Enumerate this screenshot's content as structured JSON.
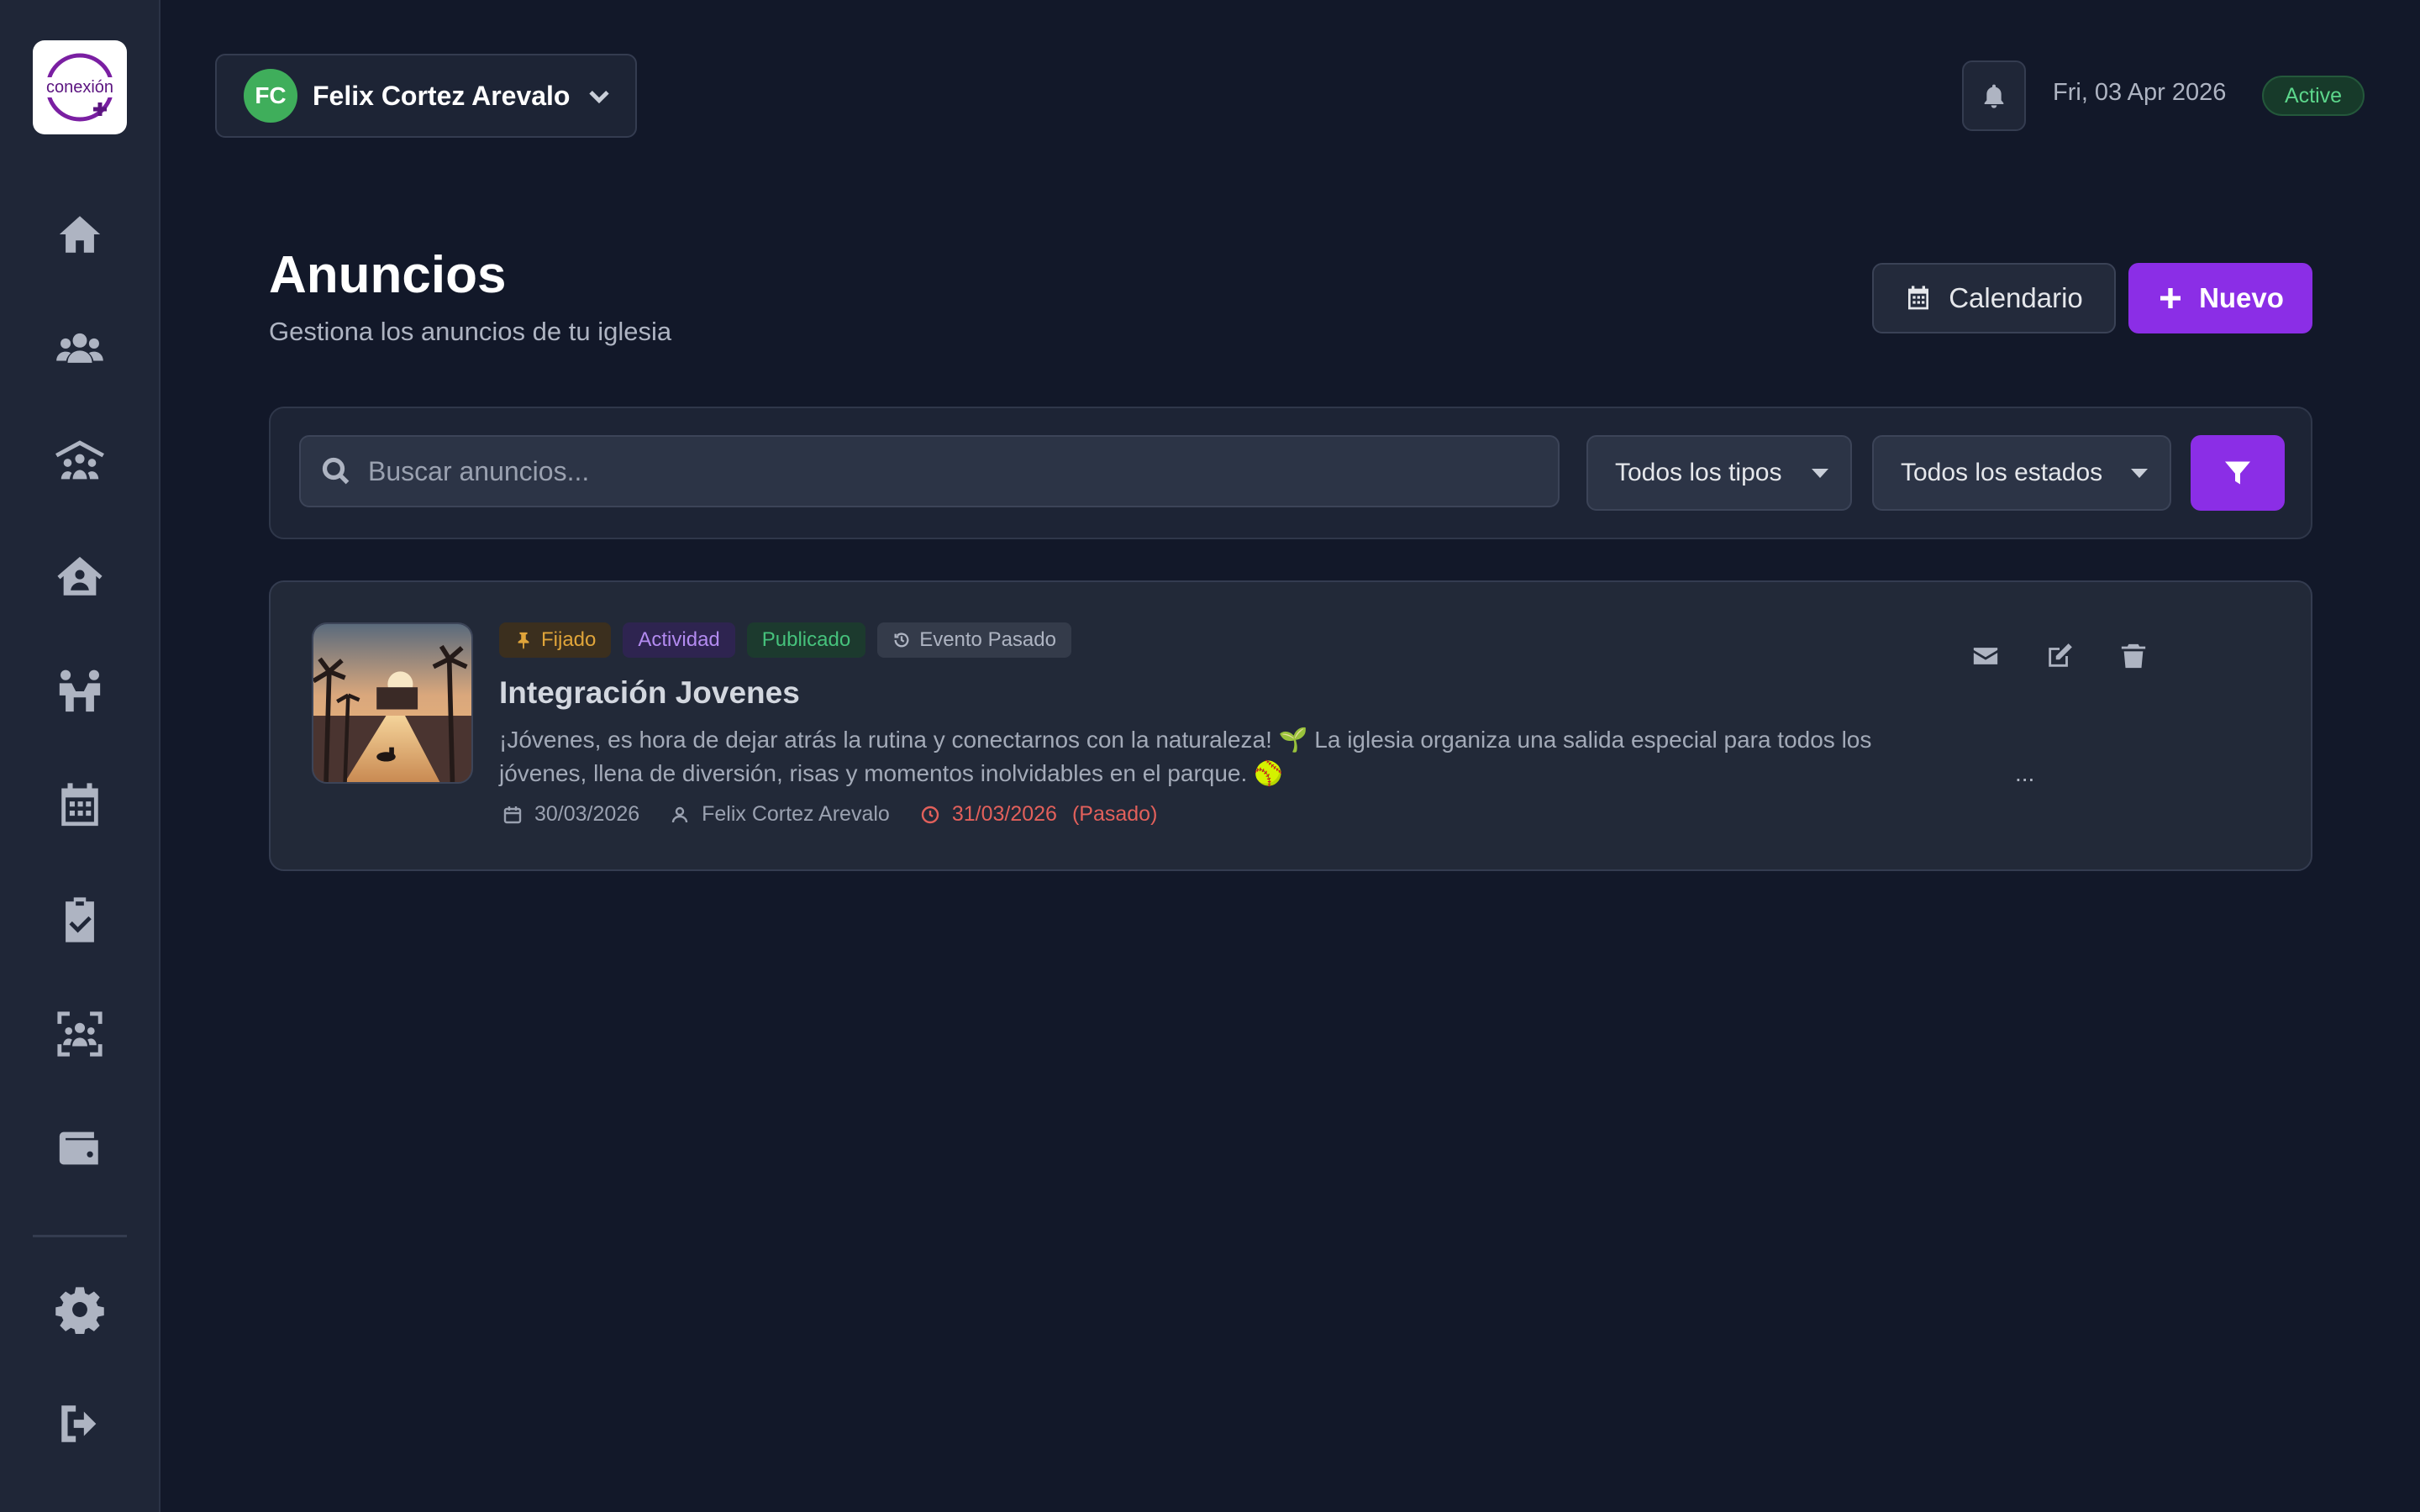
{
  "sidebar": {
    "logo_text": "conexión",
    "items": [
      {
        "name": "home",
        "icon": "home-icon"
      },
      {
        "name": "members",
        "icon": "users-icon"
      },
      {
        "name": "congregations",
        "icon": "people-roof-icon"
      },
      {
        "name": "church",
        "icon": "house-user-icon"
      },
      {
        "name": "groups",
        "icon": "people-group-icon"
      },
      {
        "name": "calendar",
        "icon": "calendar-icon"
      },
      {
        "name": "tasks",
        "icon": "clipboard-check-icon"
      },
      {
        "name": "attendance",
        "icon": "face-scan-icon"
      },
      {
        "name": "finances",
        "icon": "wallet-icon"
      },
      {
        "name": "settings",
        "icon": "gear-icon"
      },
      {
        "name": "logout",
        "icon": "logout-icon"
      }
    ]
  },
  "topbar": {
    "user_initials": "FC",
    "user_name": "Felix Cortez Arevalo",
    "date": "Fri, 03 Apr 2026",
    "status": "Active"
  },
  "header": {
    "title": "Anuncios",
    "subtitle": "Gestiona los anuncios de tu iglesia",
    "calendar_label": "Calendario",
    "new_label": "Nuevo"
  },
  "filters": {
    "search_placeholder": "Buscar anuncios...",
    "type_selected": "Todos los tipos",
    "status_selected": "Todos los estados"
  },
  "announcements": [
    {
      "badges": {
        "pinned": "Fijado",
        "type": "Actividad",
        "status": "Publicado",
        "event": "Evento Pasado"
      },
      "title": "Integración Jovenes",
      "description_line1": "¡Jóvenes, es hora de dejar atrás la rutina y conectarnos con la naturaleza! 🌱 La iglesia organiza una salida especial para todos los",
      "description_line2": "jóvenes, llena de diversión, risas y momentos inolvidables en el parque. 🥎",
      "ellipsis": "...",
      "created": "30/03/2026",
      "author": "Felix Cortez Arevalo",
      "event_date": "31/03/2026",
      "event_state": "(Pasado)"
    }
  ],
  "colors": {
    "background": "#121829",
    "sidebar": "#1f2637",
    "accent": "#8b2ee6",
    "success": "#3fae5b",
    "danger": "#e2605b"
  }
}
